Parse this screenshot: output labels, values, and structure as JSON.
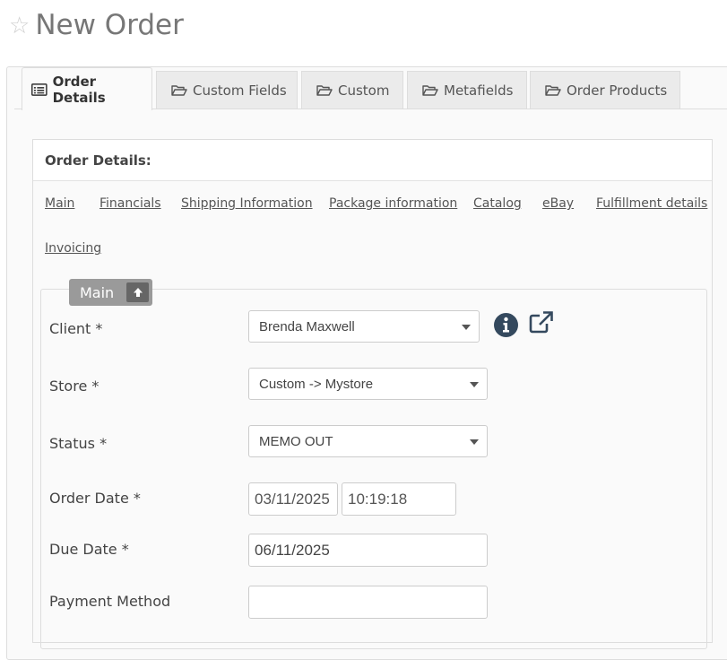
{
  "header": {
    "title": "New Order",
    "star_icon": "star-icon"
  },
  "tabs": [
    {
      "label": "Order Details",
      "icon": "list-icon",
      "active": true
    },
    {
      "label": "Custom Fields",
      "icon": "folder-open-icon"
    },
    {
      "label": "Custom",
      "icon": "folder-open-icon"
    },
    {
      "label": "Metafields",
      "icon": "folder-open-icon"
    },
    {
      "label": "Order Products",
      "icon": "folder-open-icon"
    }
  ],
  "section": {
    "title": "Order Details:",
    "links": [
      "Main",
      "Financials",
      "Shipping Information",
      "Package information",
      "Catalog",
      "eBay",
      "Fulfillment details",
      "Invoicing"
    ]
  },
  "fieldset": {
    "legend": "Main",
    "legend_icon": "arrow-up-icon"
  },
  "form": {
    "client": {
      "label": "Client *",
      "value": "Brenda Maxwell",
      "info_icon": "info-circle-icon",
      "external_icon": "external-link-icon"
    },
    "store": {
      "label": "Store *",
      "value": "Custom -> Mystore"
    },
    "status": {
      "label": "Status *",
      "value": "MEMO OUT"
    },
    "order_date": {
      "label": "Order Date *",
      "date": "03/11/2025",
      "time": "10:19:18"
    },
    "due_date": {
      "label": "Due Date *",
      "value": "06/11/2025"
    },
    "payment_method": {
      "label": "Payment Method",
      "value": ""
    }
  },
  "colors": {
    "accent": "#34495e",
    "tab_bg": "#ebebeb",
    "legend_bg": "#9a9a9a"
  }
}
